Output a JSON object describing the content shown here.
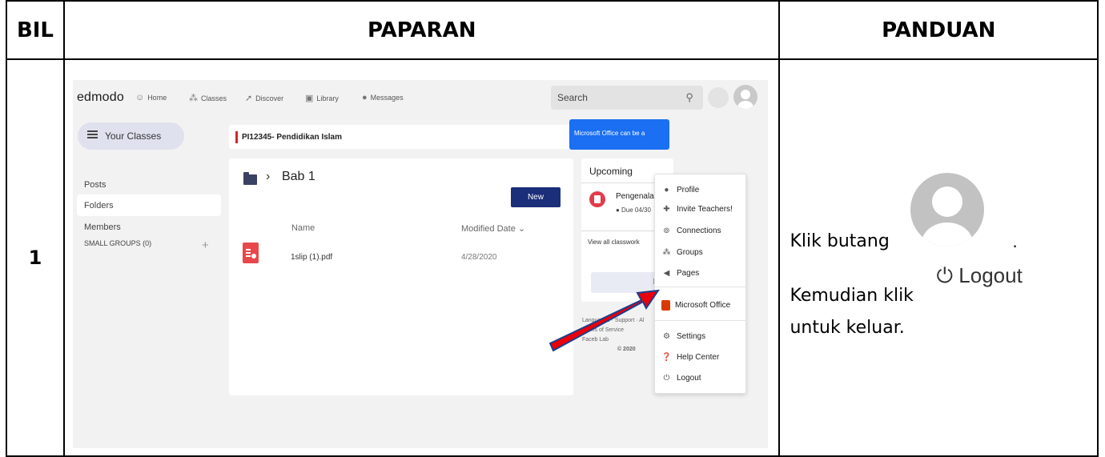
{
  "table": {
    "headers": [
      "BIL",
      "PAPARAN",
      "PANDUAN"
    ],
    "row_number": "1"
  },
  "screenshot": {
    "logo": "edmodo",
    "nav": [
      "Home",
      "Classes",
      "Discover",
      "Library",
      "Messages"
    ],
    "search_placeholder": "Search",
    "your_classes": "Your Classes",
    "sidebar_items": [
      "Posts",
      "Folders",
      "Members",
      "SMALL GROUPS (0)"
    ],
    "active_sidebar_item": "Folders",
    "class_name": "PI12345- Pendidikan Islam",
    "breadcrumb_sep": "›",
    "folder_name": "Bab 1",
    "new_button": "New",
    "columns": [
      "Name",
      "Modified Date ⌄"
    ],
    "file": {
      "name": "1slip (1).pdf",
      "modified": "4/28/2020"
    },
    "toast": "Microsoft Office can be a",
    "upcoming": {
      "title": "Upcoming",
      "event": "Pengenalar",
      "due": "Due 04/30",
      "view_all": "View all classwork"
    },
    "invite_button": "Invit",
    "footer": [
      "Languages · Support · Al",
      "Terms of Service",
      "Faceb                Lab",
      "© 2020"
    ],
    "dropdown": {
      "items": [
        "Profile",
        "Invite Teachers!",
        "Connections",
        "Groups",
        "Pages"
      ],
      "office": "Microsoft Office",
      "bottom_items": [
        "Settings",
        "Help Center",
        "Logout"
      ]
    },
    "arrow_color": "#e8000b"
  },
  "guide": {
    "line1": "Klik butang",
    "dot": ".",
    "logout_label": "Logout",
    "line2": "Kemudian klik",
    "line3": "untuk keluar."
  }
}
